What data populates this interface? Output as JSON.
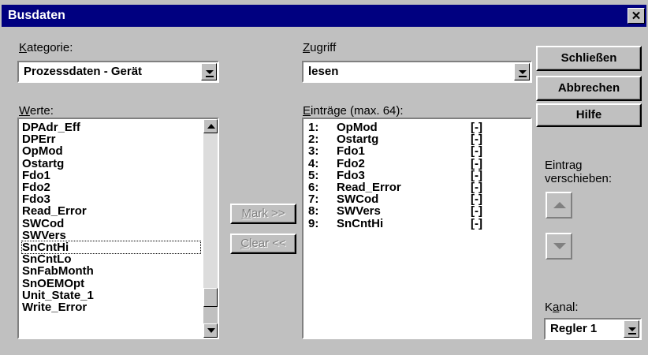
{
  "window": {
    "title": "Busdaten",
    "close_glyph": "✕"
  },
  "kategorie": {
    "label_key": "K",
    "label_rest": "ategorie:",
    "value": "Prozessdaten - Gerät"
  },
  "zugriff": {
    "label_key": "Z",
    "label_rest": "ugriff",
    "value": "lesen"
  },
  "werte": {
    "label_key": "W",
    "label_rest": "erte:",
    "items": [
      "DPAdr_Eff",
      "DPErr",
      "OpMod",
      "Ostartg",
      "Fdo1",
      "Fdo2",
      "Fdo3",
      "Read_Error",
      "SWCod",
      "SWVers",
      "SnCntHi",
      "SnCntLo",
      "SnFabMonth",
      "SnOEMOpt",
      "Unit_State_1",
      "Write_Error"
    ],
    "selected": "SnCntHi"
  },
  "eintraege": {
    "label_key": "E",
    "label_rest": "inträge (max. 64):",
    "items": [
      {
        "num": "1:",
        "name": "OpMod",
        "unit": "[-]"
      },
      {
        "num": "2:",
        "name": "Ostartg",
        "unit": "[-]"
      },
      {
        "num": "3:",
        "name": "Fdo1",
        "unit": "[-]"
      },
      {
        "num": "4:",
        "name": "Fdo2",
        "unit": "[-]"
      },
      {
        "num": "5:",
        "name": "Fdo3",
        "unit": "[-]"
      },
      {
        "num": "6:",
        "name": "Read_Error",
        "unit": "[-]"
      },
      {
        "num": "7:",
        "name": "SWCod",
        "unit": "[-]"
      },
      {
        "num": "8:",
        "name": "SWVers",
        "unit": "[-]"
      },
      {
        "num": "9:",
        "name": "SnCntHi",
        "unit": "[-]"
      }
    ]
  },
  "buttons": {
    "mark_key": "M",
    "mark_rest": "ark >>",
    "clear_key": "C",
    "clear_rest": "lear <<",
    "close": "Schließen",
    "cancel": "Abbrechen",
    "help": "Hilfe"
  },
  "move": {
    "line1": "Eintrag",
    "line2": "verschieben:"
  },
  "kanal": {
    "label_pre": "K",
    "label_key": "a",
    "label_rest": "nal:",
    "value": "Regler 1"
  },
  "icons": {
    "combo_arrow": "triangle-down",
    "scroll_up": "triangle-up",
    "scroll_down": "triangle-down"
  }
}
